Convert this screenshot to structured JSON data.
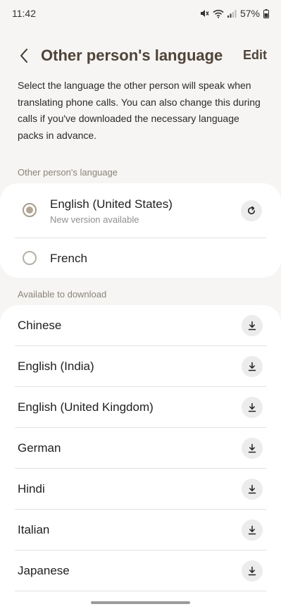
{
  "status_bar": {
    "time": "11:42",
    "battery": "57%"
  },
  "header": {
    "title": "Other person's language",
    "edit_label": "Edit"
  },
  "description": "Select the language the other person will speak when translating phone calls. You can also change this during calls if you've downloaded the necessary language packs in advance.",
  "selected_section": {
    "label": "Other person's language",
    "items": [
      {
        "name": "English (United States)",
        "subtitle": "New version available",
        "selected": true
      },
      {
        "name": "French",
        "selected": false
      }
    ]
  },
  "download_section": {
    "label": "Available to download",
    "items": [
      {
        "name": "Chinese"
      },
      {
        "name": "English (India)"
      },
      {
        "name": "English (United Kingdom)"
      },
      {
        "name": "German"
      },
      {
        "name": "Hindi"
      },
      {
        "name": "Italian"
      },
      {
        "name": "Japanese"
      }
    ]
  },
  "colors": {
    "background": "#f6f5f3",
    "card": "#ffffff",
    "title": "#4f4337",
    "radio_selected": "#b3a595",
    "secondary_text": "#8f8f8f"
  }
}
